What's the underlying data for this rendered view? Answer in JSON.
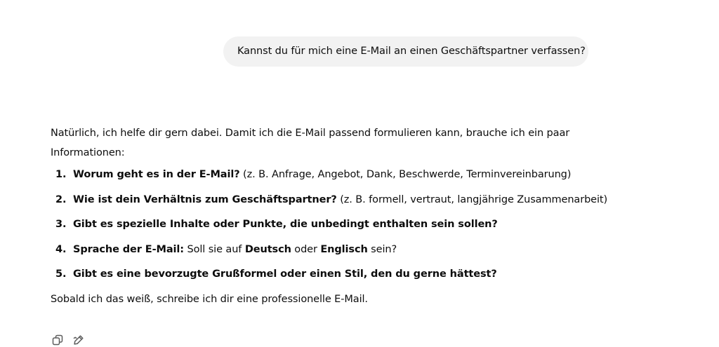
{
  "user_message": "Kannst du für mich eine E-Mail an einen Geschäftspartner verfassen?",
  "assistant": {
    "intro": "Natürlich, ich helfe dir gern dabei. Damit ich die E-Mail passend formulieren kann, brauche ich ein paar Informationen:",
    "items": [
      {
        "num": "1.",
        "bold": "Worum geht es in der E-Mail?",
        "rest": " (z. B. Anfrage, Angebot, Dank, Beschwerde, Terminvereinbarung)"
      },
      {
        "num": "2.",
        "bold": "Wie ist dein Verhältnis zum Geschäftspartner?",
        "rest": " (z. B. formell, vertraut, langjährige Zusammenarbeit)"
      },
      {
        "num": "3.",
        "bold": "Gibt es spezielle Inhalte oder Punkte, die unbedingt enthalten sein sollen?",
        "rest": ""
      },
      {
        "num": "4.",
        "bold": "Sprache der E-Mail:",
        "rest_a": " Soll sie auf ",
        "bold_b": "Deutsch",
        "rest_b": " oder ",
        "bold_c": "Englisch",
        "rest_c": " sein?"
      },
      {
        "num": "5.",
        "bold": "Gibt es eine bevorzugte Grußformel oder einen Stil, den du gerne hättest?",
        "rest": ""
      }
    ],
    "outro": "Sobald ich das weiß, schreibe ich dir eine professionelle E-Mail."
  },
  "actions": {
    "copy_icon": "copy-icon",
    "edit_icon": "edit-icon"
  }
}
